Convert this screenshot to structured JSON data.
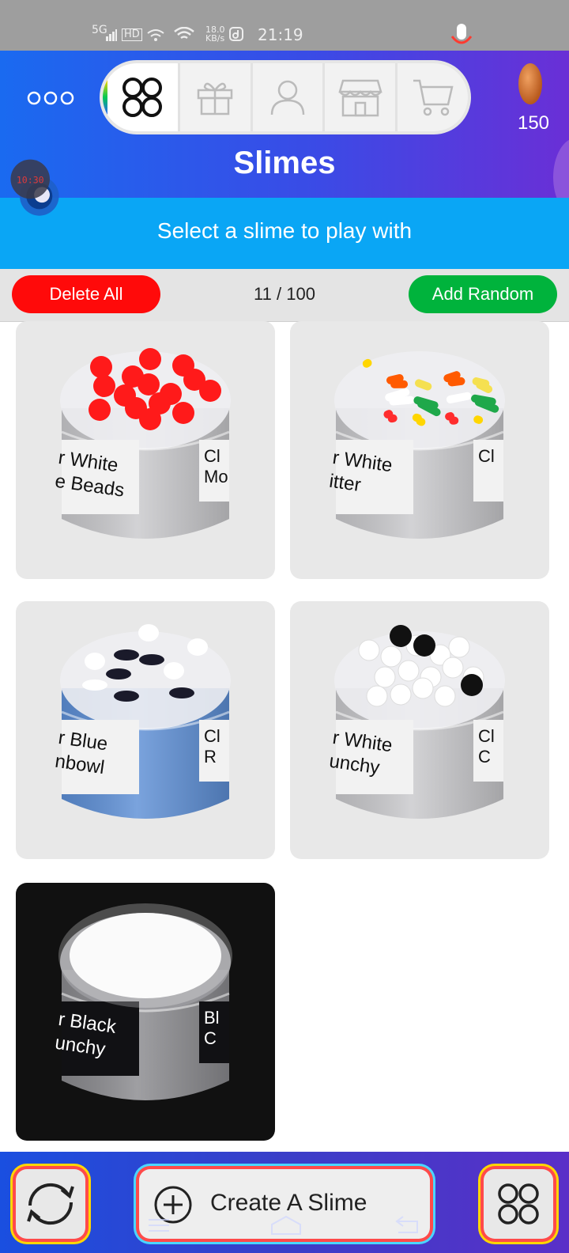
{
  "status_bar": {
    "network": "5G",
    "hd": "HD",
    "speed": "18.0",
    "speed_unit": "KB/s",
    "time": "21:19"
  },
  "header": {
    "title": "Slimes",
    "subtitle": "Select a slime to play with",
    "coins": "150",
    "overlay_clock": "10:30",
    "tabs": [
      {
        "name": "slimes",
        "icon": "four-circles-icon",
        "active": true
      },
      {
        "name": "gifts",
        "icon": "gift-icon",
        "active": false
      },
      {
        "name": "profile",
        "icon": "person-icon",
        "active": false
      },
      {
        "name": "shop",
        "icon": "store-icon",
        "active": false
      },
      {
        "name": "cart",
        "icon": "cart-icon",
        "active": false
      }
    ]
  },
  "toolbar": {
    "delete_label": "Delete All",
    "count": "11 / 100",
    "add_label": "Add Random"
  },
  "slimes": [
    {
      "label": "r White\ne Beads",
      "side": "Cl\nMo",
      "jar": "#c9c9cc",
      "theme": "light"
    },
    {
      "label": "r White\nitter",
      "side": "Cl",
      "jar": "#c9c9cc",
      "theme": "light"
    },
    {
      "label": "r Blue\nnbowl",
      "side": "Cl\nR",
      "jar": "#5d8fd6",
      "theme": "light"
    },
    {
      "label": "r White\nunchy",
      "side": "Cl\nC",
      "jar": "#c9c9cc",
      "theme": "light"
    },
    {
      "label": "r Black\nunchy",
      "side": "Bl\nC",
      "jar": "#8a8a8e",
      "theme": "dark"
    }
  ],
  "bottom": {
    "create_label": "Create A Slime"
  },
  "colors": {
    "header_start": "#1a6af0",
    "header_end": "#6a2fd6",
    "subheader": "#0aa6f5",
    "delete": "#ff0a0a",
    "add": "#00b33c"
  }
}
